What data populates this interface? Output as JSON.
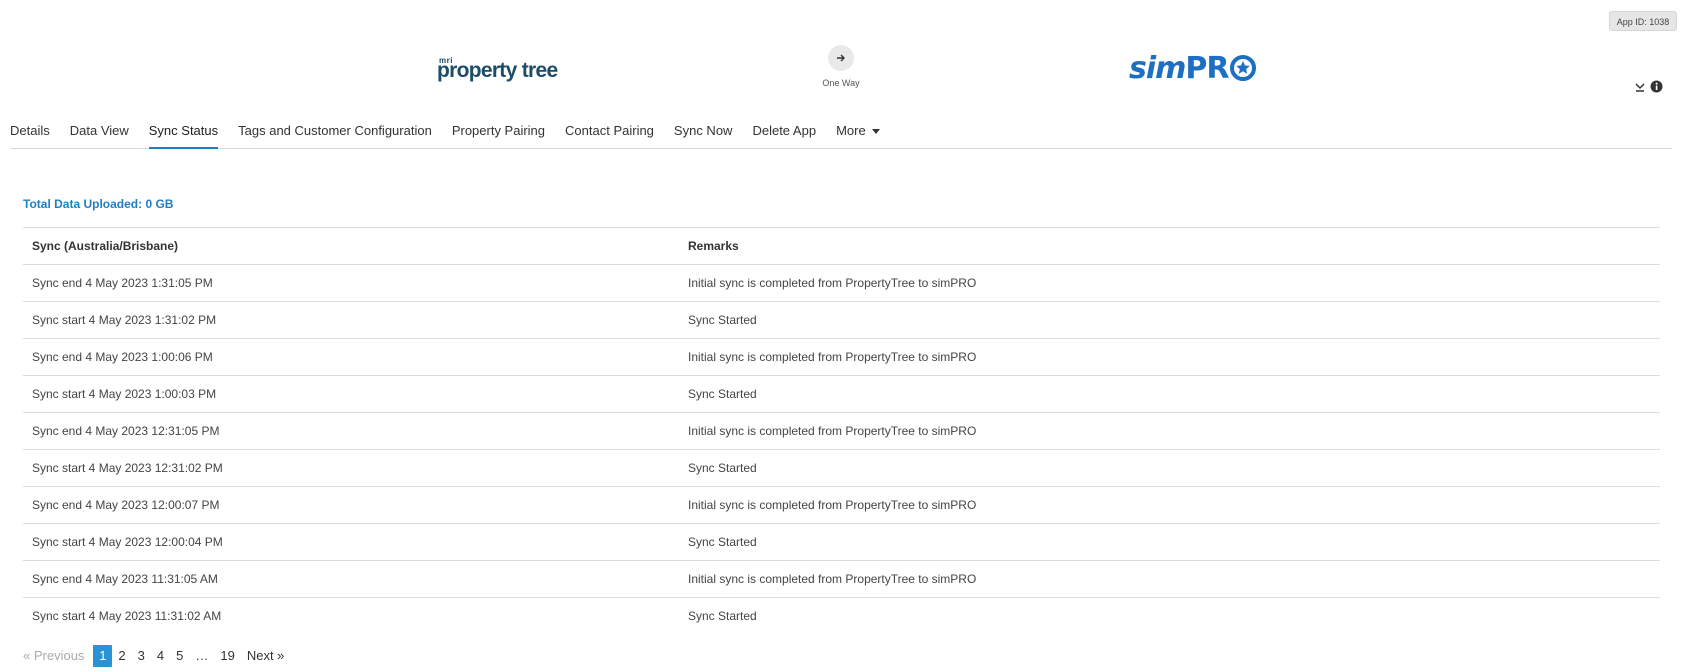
{
  "app_id": "App ID: 1038",
  "header": {
    "left_logo": {
      "prefix": "mri",
      "name": "property tree"
    },
    "direction_label": "One Way",
    "right_logo": {
      "sim": "sim",
      "pro": "PR",
      "brand_color": "#1c6fc2"
    }
  },
  "tabs": [
    {
      "label": "Details"
    },
    {
      "label": "Data View"
    },
    {
      "label": "Sync Status"
    },
    {
      "label": "Tags and Customer Configuration"
    },
    {
      "label": "Property Pairing"
    },
    {
      "label": "Contact Pairing"
    },
    {
      "label": "Sync Now"
    },
    {
      "label": "Delete App"
    },
    {
      "label": "More"
    }
  ],
  "active_tab": "Sync Status",
  "total_data": "Total Data Uploaded: 0 GB",
  "table": {
    "headers": [
      "Sync (Australia/Brisbane)",
      "Remarks"
    ],
    "rows": [
      [
        "Sync end 4 May 2023 1:31:05 PM",
        "Initial sync is completed from PropertyTree to simPRO"
      ],
      [
        "Sync start 4 May 2023 1:31:02 PM",
        "Sync Started"
      ],
      [
        "Sync end 4 May 2023 1:00:06 PM",
        "Initial sync is completed from PropertyTree to simPRO"
      ],
      [
        "Sync start 4 May 2023 1:00:03 PM",
        "Sync Started"
      ],
      [
        "Sync end 4 May 2023 12:31:05 PM",
        "Initial sync is completed from PropertyTree to simPRO"
      ],
      [
        "Sync start 4 May 2023 12:31:02 PM",
        "Sync Started"
      ],
      [
        "Sync end 4 May 2023 12:00:07 PM",
        "Initial sync is completed from PropertyTree to simPRO"
      ],
      [
        "Sync start 4 May 2023 12:00:04 PM",
        "Sync Started"
      ],
      [
        "Sync end 4 May 2023 11:31:05 AM",
        "Initial sync is completed from PropertyTree to simPRO"
      ],
      [
        "Sync start 4 May 2023 11:31:02 AM",
        "Sync Started"
      ]
    ]
  },
  "pagination": {
    "previous": "« Previous",
    "pages": [
      "1",
      "2",
      "3",
      "4",
      "5"
    ],
    "ellipsis": "…",
    "last": "19",
    "next": "Next »",
    "current": "1"
  },
  "colors": {
    "accent": "#1f7fc4",
    "active_page": "#2a93d5"
  }
}
